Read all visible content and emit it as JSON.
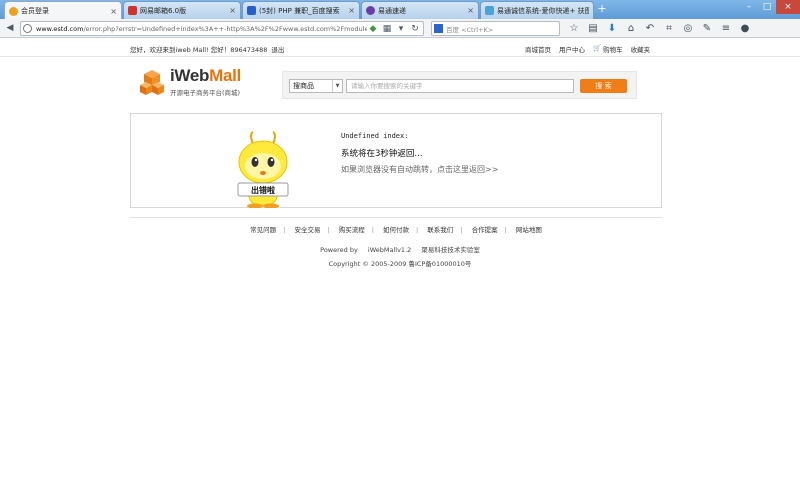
{
  "browser": {
    "tabs": [
      {
        "label": "会员登录",
        "favicon_color": "#f0a020",
        "active": true
      },
      {
        "label": "网易邮箱6.0版",
        "favicon_color": "#d0322d",
        "active": false
      },
      {
        "label": "(5封) PHP 兼职_百度搜索",
        "favicon_color": "#2b5fc8",
        "active": false
      },
      {
        "label": "易通速递",
        "favicon_color": "#6a3fa8",
        "active": false
      },
      {
        "label": "易通诚信系统-爱你快递+ 扶图通",
        "favicon_color": "#4aa3d8",
        "active": false
      }
    ],
    "close_glyph": "×",
    "new_tab_glyph": "+",
    "url_host": "www.estd.com",
    "url_rest": "/error.php?errstr=Undefined+index%3A++-http%3A%2F%2Fwww.estd.com%2Fmodules.php%3f",
    "search_placeholder": "百度 <Ctrl+K>",
    "window_buttons": [
      "–",
      "□",
      "×"
    ]
  },
  "topbar": {
    "welcome": "您好，欢迎来到iweb Mall!  您好！896473488",
    "logout": "退出",
    "links": [
      "商城首页",
      "用户中心",
      "购物车",
      "收藏夹"
    ]
  },
  "header": {
    "logo_title_a": "iWeb",
    "logo_title_b": "Mall",
    "logo_subtitle": "开源电子商务平台(商城)",
    "search_type": "搜商品",
    "search_placeholder": "请输入你要搜索的关键字",
    "search_button": "搜 索"
  },
  "error": {
    "line1": "Undefined index:",
    "line2": "系统将在3秒钟返回...",
    "line3": "如果浏览器没有自动跳转，点击这里返回>>",
    "mascot_badge": "出错啦"
  },
  "footer": {
    "links": [
      "常见问题",
      "安全交易",
      "购买流程",
      "如何付款",
      "联系我们",
      "合作提案",
      "网站地图"
    ],
    "powered_by": "Powered by",
    "product": "iWebMallv1.2",
    "dept": "聚易科技技术实验室",
    "copyright": "Copyright © 2005-2009 鲁ICP备01000010号"
  },
  "colors": {
    "accent": "#f07d16",
    "tabstrip": "#6aa6e0"
  }
}
